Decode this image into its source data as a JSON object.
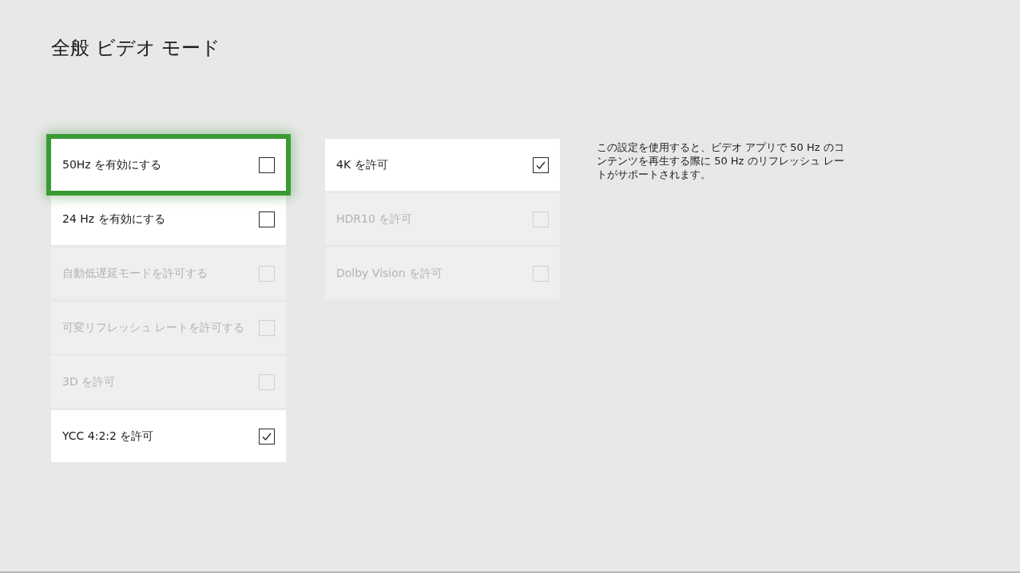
{
  "title": "全般 ビデオ モード",
  "columns": [
    {
      "items": [
        {
          "label": "50Hz を有効にする",
          "checked": false,
          "disabled": false,
          "focused": true
        },
        {
          "label": "24 Hz を有効にする",
          "checked": false,
          "disabled": false,
          "focused": false
        },
        {
          "label": "自動低遅延モードを許可する",
          "checked": false,
          "disabled": true,
          "focused": false
        },
        {
          "label": "可変リフレッシュ レートを許可する",
          "checked": false,
          "disabled": true,
          "focused": false
        },
        {
          "label": "3D を許可",
          "checked": false,
          "disabled": true,
          "focused": false
        },
        {
          "label": "YCC 4:2:2 を許可",
          "checked": true,
          "disabled": false,
          "focused": false
        }
      ]
    },
    {
      "items": [
        {
          "label": "4K を許可",
          "checked": true,
          "disabled": false,
          "focused": false
        },
        {
          "label": "HDR10 を許可",
          "checked": false,
          "disabled": true,
          "focused": false
        },
        {
          "label": "Dolby Vision を許可",
          "checked": false,
          "disabled": true,
          "focused": false
        }
      ]
    }
  ],
  "description": "この設定を使用すると、ビデオ アプリで 50 Hz のコンテンツを再生する際に 50 Hz のリフレッシュ レートがサポートされます。"
}
